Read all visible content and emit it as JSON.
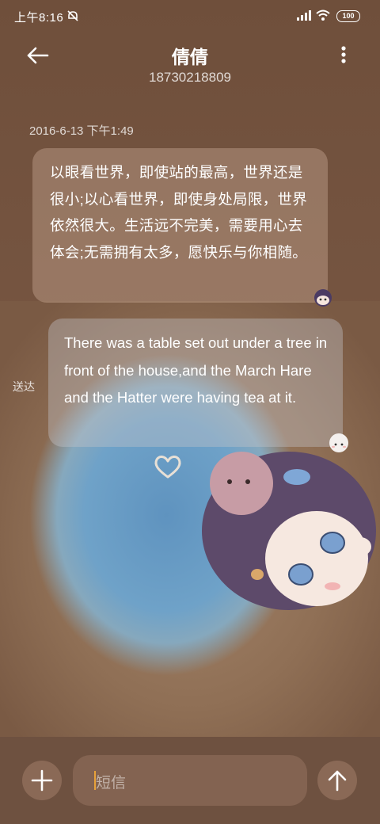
{
  "status_bar": {
    "time": "上午8:16",
    "battery": "100"
  },
  "header": {
    "contact_name": "倩倩",
    "contact_number": "18730218809"
  },
  "conversation": {
    "timestamp": "2016-6-13 下午1:49",
    "messages": [
      {
        "direction": "incoming",
        "text": "以眼看世界，即使站的最高，世界还是很小;以心看世界，即使身处局限，世界依然很大。生活远不完美，需要用心去体会;无需拥有太多，愿快乐与你相随。"
      },
      {
        "direction": "outgoing",
        "text": "There was a table set out under a tree in front of the house,and the March Hare and the Hatter were having tea at it.",
        "status": "送达"
      }
    ]
  },
  "composer": {
    "placeholder": "短信"
  },
  "icons": {
    "back": "arrow-left-icon",
    "more": "more-vertical-icon",
    "add": "plus-icon",
    "send": "arrow-up-icon"
  }
}
